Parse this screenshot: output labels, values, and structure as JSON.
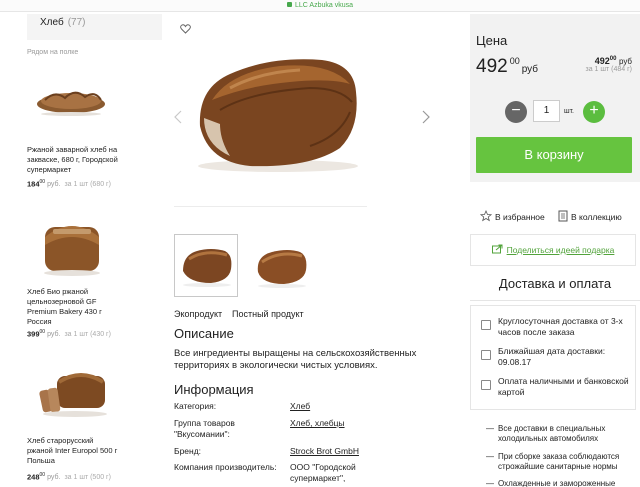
{
  "browser": {
    "url_label": "LLC Azbuka vkusa"
  },
  "sidebar": {
    "category": "Хлеб",
    "category_count": "(77)",
    "nearby_label": "Рядом на полке",
    "products": [
      {
        "name": "Ржаной заварной хлеб на закваске, 680 г, Городской супермаркет",
        "price_main": "184",
        "price_cents": "00",
        "unit": "руб.",
        "per_unit": "за 1 шт (680 г)"
      },
      {
        "name": "Хлеб Био ржаной цельнозерновой GF Premium Bakery 430 г Россия",
        "price_main": "399",
        "price_cents": "00",
        "unit": "руб.",
        "per_unit": "за 1 шт (430 г)"
      },
      {
        "name": "Хлеб старорусский ржаной Inter Europol 500 г Польша",
        "price_main": "248",
        "price_cents": "00",
        "unit": "руб.",
        "per_unit": "за 1 шт (500 г)"
      }
    ]
  },
  "main": {
    "tags": [
      "Экопродукт",
      "Постный продукт"
    ],
    "description_heading": "Описание",
    "description": "Все ингредиенты выращены на сельскохозяйственных территориях в экологически чистых условиях.",
    "info_heading": "Информация",
    "info_rows": [
      {
        "label": "Категория:",
        "value": "Хлеб"
      },
      {
        "label": "Группа товаров \"Вкусомании\":",
        "value": "Хлеб, хлебцы"
      },
      {
        "label": "Бренд:",
        "value": "Strock Brot GmbH"
      },
      {
        "label": "Компания производитель:",
        "value": "ООО \"Городской супермаркет\","
      }
    ]
  },
  "buy": {
    "price_label": "Цена",
    "price_main": "492",
    "price_cents": "00",
    "currency": "руб",
    "unit_price_main": "492",
    "unit_price_cents": "00",
    "unit_currency": "руб",
    "unit_desc": "за 1 шт (484 г)",
    "minus": "−",
    "quantity": "1",
    "quantity_unit": "шт.",
    "plus": "+",
    "cart_button": "В корзину",
    "favorites": "В избранное",
    "collection": "В коллекцию",
    "share": "Поделиться идеей подарка"
  },
  "delivery": {
    "heading": "Доставка и оплата",
    "items": [
      "Круглосуточная доставка от 3-х часов после заказа",
      "Ближайшая дата доставки: 09.08.17",
      "Оплата наличными и банковской картой"
    ],
    "bullets": [
      "Все доставки в специальных холодильных автомобилях",
      "При сборке заказа соблюдаются строжайшие санитарные нормы",
      "Охлажденные и замороженные"
    ]
  },
  "colors": {
    "accent_green": "#66c43f",
    "link_green": "#52a33b"
  }
}
